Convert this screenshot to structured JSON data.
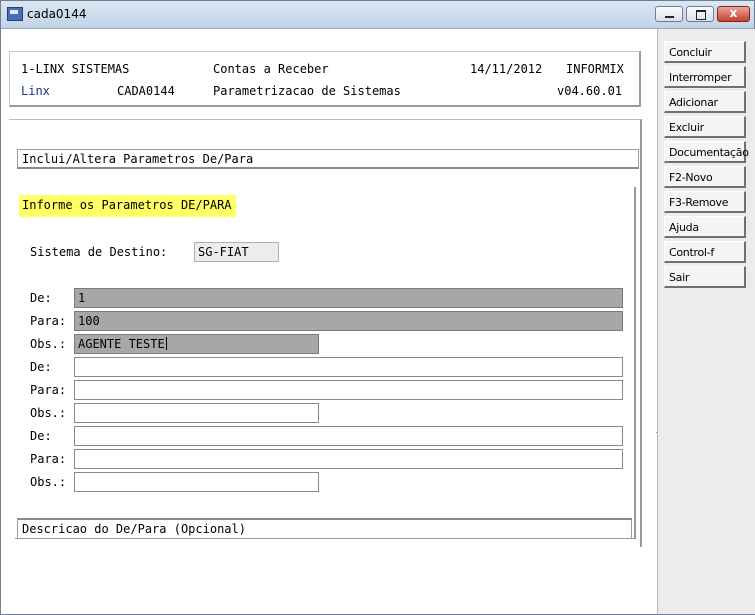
{
  "window": {
    "title": "cada0144",
    "close_glyph": "x"
  },
  "header": {
    "company": "1-LINX SISTEMAS",
    "module": "Contas a Receber",
    "date": "14/11/2012",
    "database": "INFORMIX",
    "brand": "Linx",
    "program": "CADA0144",
    "description": "Parametrizacao de Sistemas",
    "version": "v04.60.01"
  },
  "operation": "Inclui/Altera Parametros De/Para",
  "prompt": "Informe os Parametros DE/PARA",
  "destino": {
    "label": "Sistema de Destino:",
    "value": "SG-FIAT"
  },
  "labels": {
    "de": "De:",
    "para": "Para:",
    "obs": "Obs.:"
  },
  "entries": [
    {
      "de": "1",
      "para": "100",
      "obs": "AGENTE TESTE"
    },
    {
      "de": "",
      "para": "",
      "obs": ""
    },
    {
      "de": "",
      "para": "",
      "obs": ""
    }
  ],
  "status_bar": "Descricao do De/Para (Opcional)",
  "side_buttons": [
    "Concluir",
    "Interromper",
    "Adicionar",
    "Excluir",
    "Documentação",
    "F2-Novo",
    "F3-Remove",
    "Ajuda",
    "Control-f",
    "Sair"
  ],
  "colors": {
    "highlight": "#ffff66",
    "filled_field": "#a7a7a7",
    "brand_blue": "#1a2f88"
  },
  "icons": [
    "app-icon",
    "minimize-icon",
    "maximize-icon",
    "close-icon"
  ]
}
